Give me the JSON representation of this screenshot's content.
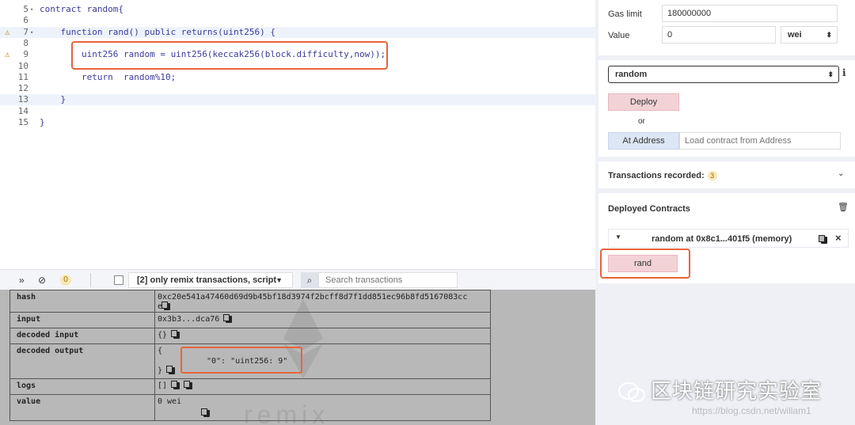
{
  "editor": {
    "lines": [
      {
        "num": "5",
        "fold": "▾",
        "warn": false,
        "hl": false,
        "code": "contract random{"
      },
      {
        "num": "6",
        "fold": "",
        "warn": false,
        "hl": false,
        "code": ""
      },
      {
        "num": "7",
        "fold": "▾",
        "warn": true,
        "hl": true,
        "code": "    function rand() public returns(uint256) {"
      },
      {
        "num": "8",
        "fold": "",
        "warn": false,
        "hl": false,
        "code": ""
      },
      {
        "num": "9",
        "fold": "",
        "warn": true,
        "hl": false,
        "code": "        uint256 random = uint256(keccak256(block.difficulty,now));"
      },
      {
        "num": "10",
        "fold": "",
        "warn": false,
        "hl": false,
        "code": ""
      },
      {
        "num": "11",
        "fold": "",
        "warn": false,
        "hl": false,
        "code": "        return  random%10;"
      },
      {
        "num": "12",
        "fold": "",
        "warn": false,
        "hl": false,
        "code": ""
      },
      {
        "num": "13",
        "fold": "",
        "warn": false,
        "hl": true,
        "code": "    }"
      },
      {
        "num": "14",
        "fold": "",
        "warn": false,
        "hl": false,
        "code": ""
      },
      {
        "num": "15",
        "fold": "",
        "warn": false,
        "hl": false,
        "code": "}"
      }
    ]
  },
  "terminal": {
    "collapse_icon": "double-chevron-down-icon",
    "clear_icon": "ban-icon",
    "pending_count": "0",
    "filter_label": "[2] only remix transactions, script",
    "search_placeholder": "Search transactions"
  },
  "transaction": {
    "hash_key": "hash",
    "hash_value": "0xc20e541a47460d69d9b45bf18d3974f2bcff8d7f1dd851ec96b8fd5167083cc\ne",
    "input_key": "input",
    "input_value": "0x3b3...dca76",
    "decoded_input_key": "decoded input",
    "decoded_input_value": "{}",
    "decoded_output_key": "decoded output",
    "decoded_output_open": "{",
    "decoded_output_value": "\"0\": \"uint256: 9\"",
    "decoded_output_close": "}",
    "logs_key": "logs",
    "logs_value": "[]",
    "value_key": "value",
    "value_value": "0 wei",
    "watermark": "remix"
  },
  "run_panel": {
    "gas_limit_label": "Gas limit",
    "gas_limit_value": "180000000",
    "value_label": "Value",
    "value_amount": "0",
    "value_unit": "wei",
    "contract_selected": "random",
    "deploy_label": "Deploy",
    "or_label": "or",
    "at_address_label": "At Address",
    "at_address_placeholder": "Load contract from Address",
    "tx_recorded_label": "Transactions recorded:",
    "tx_recorded_count": "3",
    "deployed_title": "Deployed Contracts",
    "instance_label": "random at 0x8c1...401f5 (memory)",
    "rand_label": "rand"
  },
  "overlay": {
    "wechat_label": "区块链研究实验室",
    "csdn_url": "https://blog.csdn.net/willam1"
  },
  "colors": {
    "highlight_border": "#e8643c",
    "deploy_bg": "#f3d2d6",
    "at_address_bg": "#dde6f5",
    "keyword": "#3a3a9a"
  }
}
